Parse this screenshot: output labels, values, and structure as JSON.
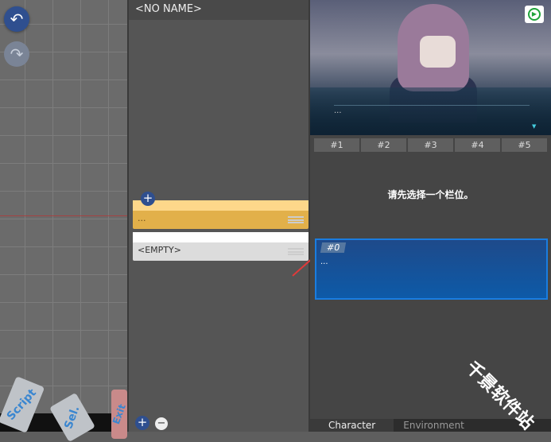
{
  "toolbar": {
    "undo_icon": "undo-icon",
    "redo_icon": "redo-icon"
  },
  "dock": {
    "chips": [
      "Script",
      "Sel.",
      "Exit"
    ]
  },
  "middle": {
    "title": "<NO NAME>",
    "nodes": [
      {
        "text": "..."
      },
      {
        "text": "<EMPTY>"
      }
    ],
    "add_label": "+",
    "remove_label": "−"
  },
  "preview": {
    "dialog_text": "...",
    "play_icon": "play-icon"
  },
  "slots": [
    "#1",
    "#2",
    "#3",
    "#4",
    "#5"
  ],
  "message": "请先选择一个栏位。",
  "selected_card": {
    "tag": "#0",
    "text": "..."
  },
  "bottom_tabs": [
    "Character",
    "Environment"
  ],
  "watermark": "千景软件站",
  "colors": {
    "accent": "#2f4f8f",
    "node_yellow": "#e2b04a",
    "card_blue": "#0d5aa8"
  }
}
